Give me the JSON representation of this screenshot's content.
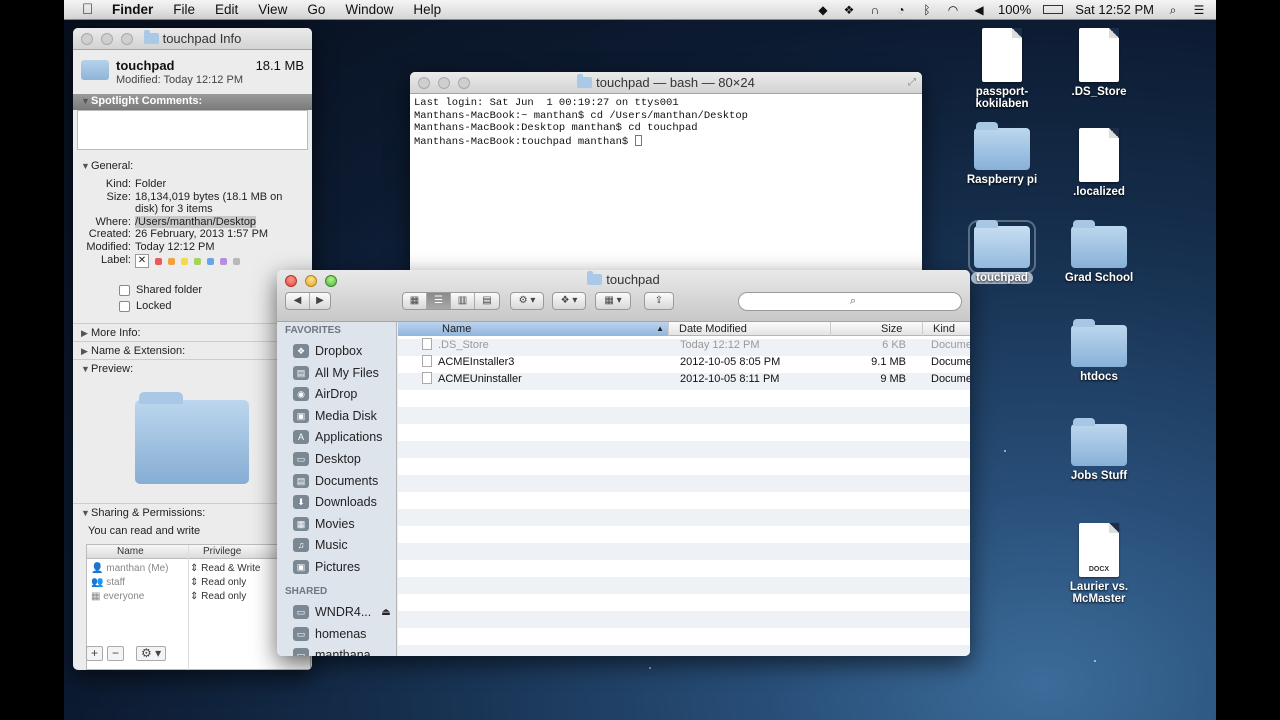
{
  "menubar": {
    "apple": "",
    "menus": [
      "Finder",
      "File",
      "Edit",
      "View",
      "Go",
      "Window",
      "Help"
    ],
    "battery": "100%",
    "clock": "Sat 12:52 PM"
  },
  "info": {
    "title": "touchpad Info",
    "name": "touchpad",
    "modified_line": "Modified: Today 12:12 PM",
    "size_header": "18.1 MB",
    "spotlight": "Spotlight Comments:",
    "general": "General:",
    "kind_k": "Kind:",
    "kind_v": "Folder",
    "size_k": "Size:",
    "size_v": "18,134,019 bytes (18.1 MB on disk) for 3 items",
    "where_k": "Where:",
    "where_v": "/Users/manthan/Desktop",
    "created_k": "Created:",
    "created_v": "26 February, 2013 1:57 PM",
    "modified_k": "Modified:",
    "modified_v": "Today 12:12 PM",
    "label_k": "Label:",
    "label_colors": [
      "#e8595a",
      "#f4a23e",
      "#f5d94c",
      "#a3d45c",
      "#6aa3e8",
      "#b48ee0",
      "#b8b8b8"
    ],
    "shared_folder": "Shared folder",
    "locked": "Locked",
    "more_info": "More Info:",
    "name_ext": "Name & Extension:",
    "preview": "Preview:",
    "sharing": "Sharing & Permissions:",
    "sharing_note": "You can read and write",
    "perm_head_name": "Name",
    "perm_head_priv": "Privilege",
    "perms": [
      {
        "name": "manthan (Me)",
        "priv": "Read & Write"
      },
      {
        "name": "staff",
        "priv": "Read only"
      },
      {
        "name": "everyone",
        "priv": "Read only"
      }
    ],
    "plus": "+",
    "minus": "−",
    "gear": "⚙ ▾"
  },
  "terminal": {
    "title": "touchpad — bash — 80×24",
    "lines": [
      "Last login: Sat Jun  1 00:19:27 on ttys001",
      "Manthans-MacBook:~ manthan$ cd /Users/manthan/Desktop",
      "Manthans-MacBook:Desktop manthan$ cd touchpad",
      "Manthans-MacBook:touchpad manthan$ "
    ]
  },
  "finder": {
    "title": "touchpad",
    "search_placeholder": "",
    "favorites_header": "FAVORITES",
    "favorites": [
      "Dropbox",
      "All My Files",
      "AirDrop",
      "Media Disk",
      "Applications",
      "Desktop",
      "Documents",
      "Downloads",
      "Movies",
      "Music",
      "Pictures"
    ],
    "shared_header": "SHARED",
    "shared": [
      "WNDR4...",
      "homenas",
      "manthana..."
    ],
    "columns": {
      "name": "Name",
      "date": "Date Modified",
      "size": "Size",
      "kind": "Kind"
    },
    "files": [
      {
        "name": ".DS_Store",
        "date": "Today 12:12 PM",
        "size": "6 KB",
        "kind": "Document",
        "dim": true
      },
      {
        "name": "ACMEInstaller3",
        "date": "2012-10-05 8:05 PM",
        "size": "9.1 MB",
        "kind": "Document",
        "dim": false
      },
      {
        "name": "ACMEUninstaller",
        "date": "2012-10-05 8:11 PM",
        "size": "9 MB",
        "kind": "Document",
        "dim": false
      }
    ]
  },
  "desktop": [
    {
      "label": "passport-kokilaben",
      "type": "page"
    },
    {
      "label": ".DS_Store",
      "type": "page"
    },
    {
      "label": "Raspberry pi",
      "type": "folder"
    },
    {
      "label": ".localized",
      "type": "page"
    },
    {
      "label": "touchpad",
      "type": "folder"
    },
    {
      "label": "Grad School",
      "type": "folder"
    },
    {
      "label": "htdocs",
      "type": "folder"
    },
    {
      "label": "Jobs Stuff",
      "type": "folder"
    },
    {
      "label": "Laurier vs. McMaster",
      "type": "docx"
    }
  ],
  "docx_badge": "DOCX"
}
